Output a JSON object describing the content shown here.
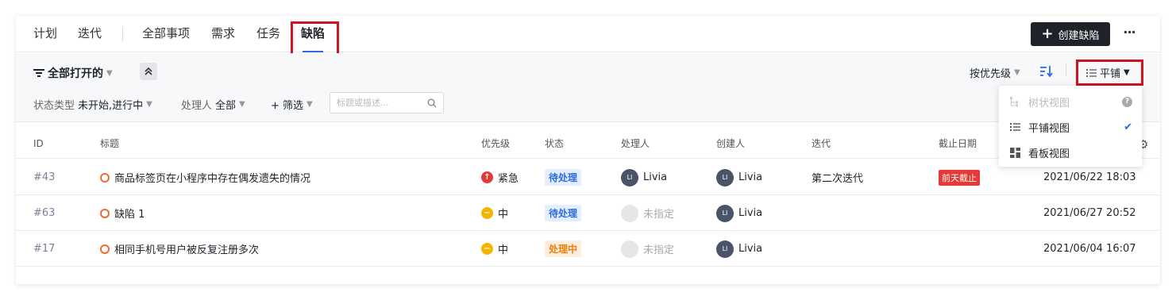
{
  "nav": {
    "tabs": [
      {
        "label": "计划"
      },
      {
        "label": "迭代"
      },
      {
        "label": "全部事项"
      },
      {
        "label": "需求"
      },
      {
        "label": "任务"
      },
      {
        "label": "缺陷"
      }
    ],
    "active_tab": "缺陷",
    "create_label": "创建缺陷",
    "more_label": "···"
  },
  "filters": {
    "view_name": "全部打开的",
    "status_type_label": "状态类型",
    "status_type_value": "未开始,进行中",
    "assignee_label": "处理人",
    "assignee_value": "全部",
    "add_filter_label": "+ 筛选",
    "search_placeholder": "标题或描述...",
    "sort_label": "按优先级",
    "layout_label": "平铺"
  },
  "view_menu": {
    "items": [
      {
        "label": "树状视图",
        "icon": "tree-icon",
        "disabled": true
      },
      {
        "label": "平铺视图",
        "icon": "list-icon",
        "selected": true
      },
      {
        "label": "看板视图",
        "icon": "board-icon"
      }
    ]
  },
  "table": {
    "columns": [
      "ID",
      "标题",
      "优先级",
      "状态",
      "处理人",
      "创建人",
      "迭代",
      "截止日期"
    ],
    "rows": [
      {
        "id": "#43",
        "title": "商品标签页在小程序中存在偶发遗失的情况",
        "priority": "紧急",
        "status": "待处理",
        "assignee": "Livia",
        "creator": "Livia",
        "iteration": "第二次迭代",
        "due_tag": "前天截止",
        "due": "2021/06/22 18:03"
      },
      {
        "id": "#63",
        "title": "缺陷 1",
        "priority": "中",
        "status": "待处理",
        "assignee": "未指定",
        "creator": "Livia",
        "iteration": "",
        "due_tag": "",
        "due": "2021/06/27 20:52"
      },
      {
        "id": "#17",
        "title": "相同手机号用户被反复注册多次",
        "priority": "中",
        "status": "处理中",
        "assignee": "未指定",
        "creator": "Livia",
        "iteration": "",
        "due_tag": "",
        "due": "2021/06/04 16:07"
      }
    ]
  },
  "colors": {
    "accent": "#2d6ae0",
    "highlight_box": "#d0131f",
    "urgent": "#e53935",
    "medium": "#f5b400",
    "status_todo_bg": "#e3efff",
    "status_todo_fg": "#2d6ae0",
    "status_doing_bg": "#ffeddc",
    "status_doing_fg": "#e6800a"
  }
}
